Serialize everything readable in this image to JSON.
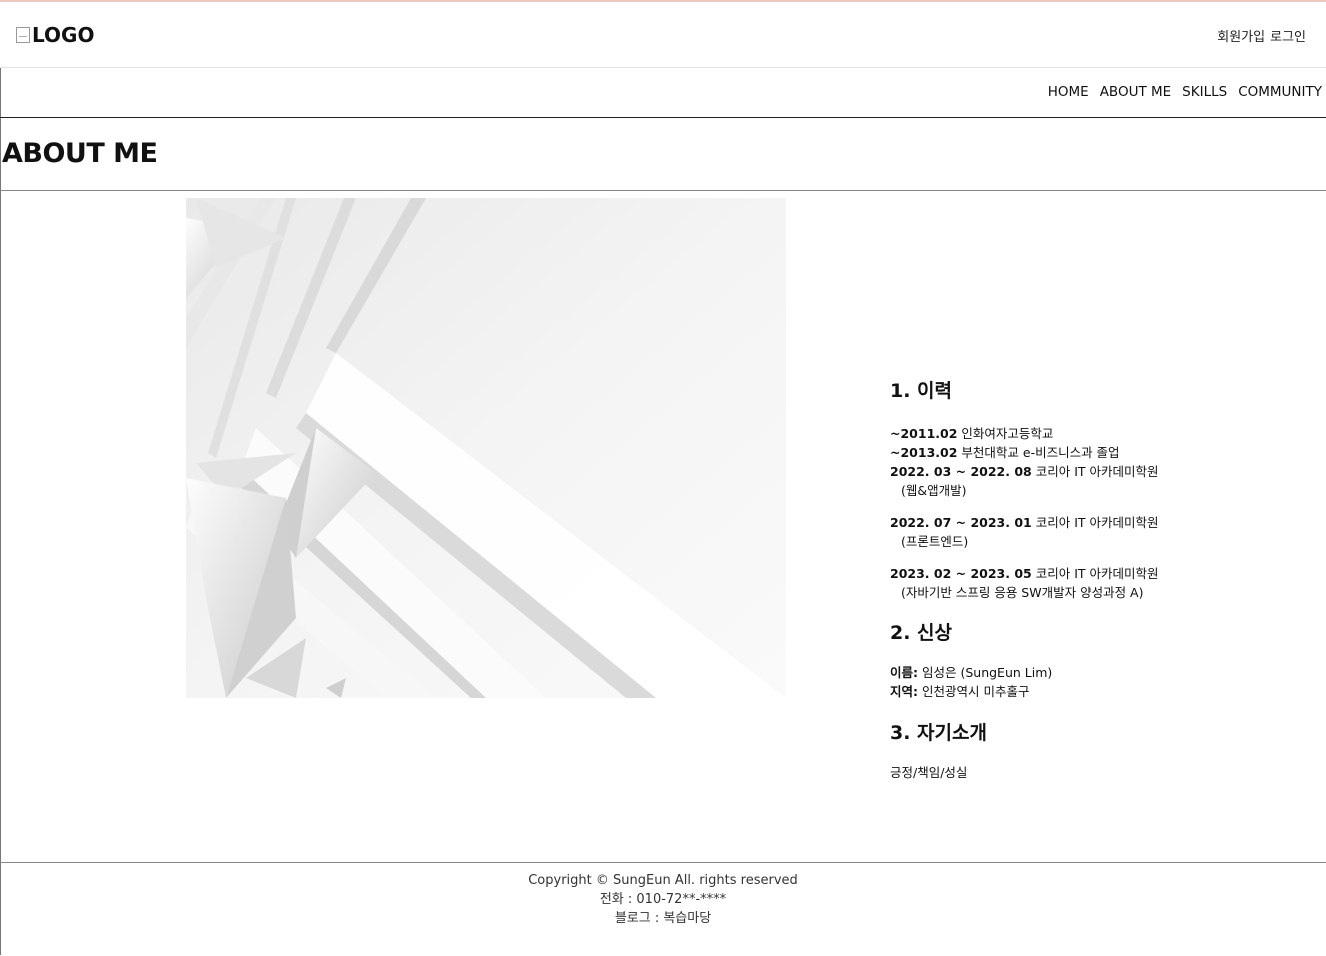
{
  "header": {
    "logo_alt": "LOGO",
    "signup_label": "회원가입",
    "login_label": "로그인"
  },
  "nav": {
    "items": [
      "HOME",
      "ABOUT ME",
      "SKILLS",
      "COMMUNITY"
    ]
  },
  "page": {
    "title": "ABOUT ME"
  },
  "hero": {
    "image": "abstract-white-geometric-background"
  },
  "profile": {
    "history": {
      "heading": "1. 이력",
      "entries": [
        {
          "date": "~2011.02",
          "text": "인화여자고등학교",
          "note": ""
        },
        {
          "date": "~2013.02",
          "text": "부천대학교 e-비즈니스과 졸업",
          "note": ""
        },
        {
          "date": "2022. 03 ~ 2022. 08",
          "text": "코리아 IT 아카데미학원",
          "note": "(웹&앱개발)"
        },
        {
          "date": "2022. 07 ~ 2023. 01",
          "text": "코리아 IT 아카데미학원",
          "note": "(프론트엔드)"
        },
        {
          "date": "2023. 02 ~ 2023. 05",
          "text": "코리아 IT 아카데미학원",
          "note": "(자바기반 스프링 응용 SW개발자 양성과정 A)"
        }
      ]
    },
    "personal": {
      "heading": "2. 신상",
      "name_label": "이름:",
      "name_value": "임성은 (SungEun Lim)",
      "region_label": "지역:",
      "region_value": "인천광역시 미추홀구"
    },
    "intro": {
      "heading": "3. 자기소개",
      "text": "긍정/책임/성실"
    }
  },
  "footer": {
    "copyright": "Copyright © SungEun All. rights reserved",
    "phone": "전화 : 010-72**-****",
    "blog": "블로그 : 복습마당"
  },
  "colors": {
    "text": "#111111",
    "rule": "#888888",
    "top_accent": "#e7c8c2"
  }
}
